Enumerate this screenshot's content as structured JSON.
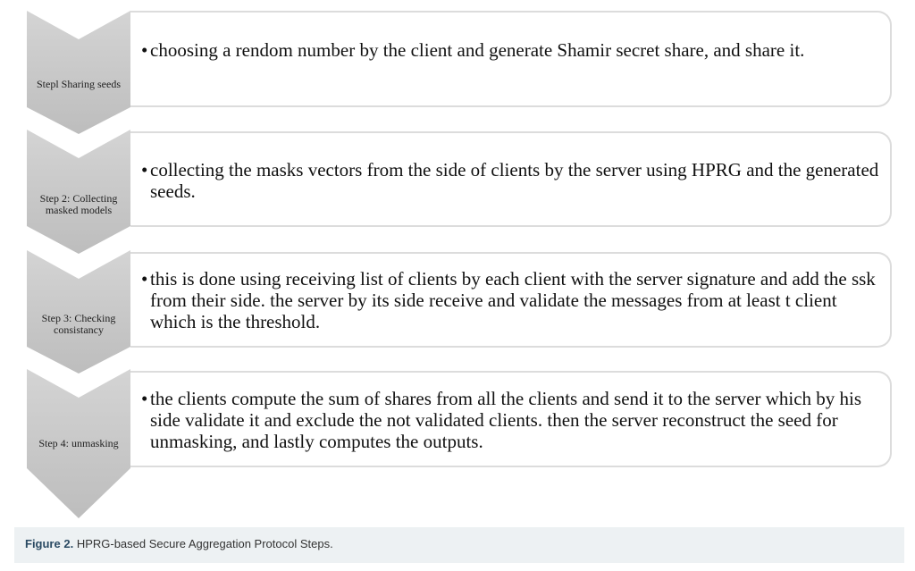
{
  "steps": [
    {
      "label": "Stepl Sharing seeds",
      "text": "choosing a rendom number by the client and generate Shamir secret share, and share it."
    },
    {
      "label": "Step 2: Collecting masked models",
      "text": "collecting the masks vectors from the side of clients by the server using HPRG and the generated seeds."
    },
    {
      "label": "Step 3: Checking consistancy",
      "text": "this is done using receiving list of clients by each client with the server signature and add the ssk from their side. the server by its side receive and validate the messages from at least t client which is the threshold."
    },
    {
      "label": "Step 4: unmasking",
      "text": "the clients compute the sum of shares from all the clients and send it to the server which by his side validate it and exclude the not validated clients. then the server reconstruct the seed for unmasking, and lastly computes the outputs."
    }
  ],
  "caption": {
    "label": "Figure 2.",
    "text": "HPRG-based Secure Aggregation Protocol Steps."
  },
  "colors": {
    "chevron": "#c8c8c8",
    "box_border": "#dcdcdc",
    "caption_bg": "#edf1f3"
  }
}
